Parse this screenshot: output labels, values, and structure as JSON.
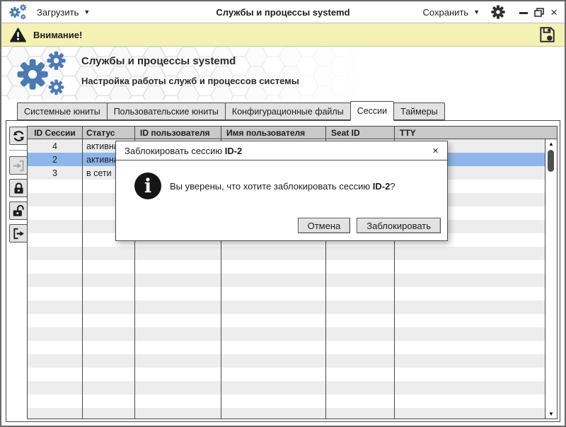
{
  "titlebar": {
    "load_label": "Загрузить",
    "title": "Службы и процессы systemd",
    "save_label": "Сохранить"
  },
  "warning": {
    "label": "Внимание!"
  },
  "banner": {
    "title": "Службы и процессы systemd",
    "subtitle": "Настройка работы служб и процессов системы"
  },
  "tabs": [
    {
      "label": "Системные юниты",
      "active": false
    },
    {
      "label": "Пользовательские юниты",
      "active": false
    },
    {
      "label": "Конфигурационные файлы",
      "active": false
    },
    {
      "label": "Сессии",
      "active": true
    },
    {
      "label": "Таймеры",
      "active": false
    }
  ],
  "toolbar": {
    "buttons": [
      {
        "icon": "refresh-icon",
        "enabled": true
      },
      {
        "icon": "attach-session-icon",
        "enabled": false
      },
      {
        "icon": "lock-session-icon",
        "enabled": true
      },
      {
        "icon": "unlock-session-icon",
        "enabled": true
      },
      {
        "icon": "terminate-session-icon",
        "enabled": true
      }
    ]
  },
  "table": {
    "columns": [
      "ID Сессии",
      "Статус",
      "ID пользователя",
      "Имя пользователя",
      "Seat ID",
      "TTY"
    ],
    "rows": [
      {
        "session_id": "4",
        "status": "активна",
        "user_id": "",
        "user_name": "",
        "seat_id": "",
        "tty": "",
        "selected": false
      },
      {
        "session_id": "2",
        "status": "активна",
        "user_id": "",
        "user_name": "",
        "seat_id": "",
        "tty": "",
        "selected": true
      },
      {
        "session_id": "3",
        "status": "в сети",
        "user_id": "",
        "user_name": "",
        "seat_id": "",
        "tty": "",
        "selected": false
      }
    ]
  },
  "dialog": {
    "title_prefix": "Заблокировать сессию ",
    "session_id": "ID-2",
    "message_prefix": "Вы уверены, что хотите заблокировать сессию ",
    "message_suffix": "?",
    "cancel_label": "Отмена",
    "confirm_label": "Заблокировать"
  },
  "icons": {
    "dropdown": "▼",
    "minimize": "",
    "close": "×",
    "scroll_up": "▲",
    "scroll_down": "▼",
    "info": "i"
  },
  "colors": {
    "accent_blue": "#4a7ab5",
    "selection_blue": "#8fb6ea",
    "warning_yellow": "#f4f1b5",
    "header_gray": "#c9c9c9",
    "stripe_gray": "#ededed"
  }
}
